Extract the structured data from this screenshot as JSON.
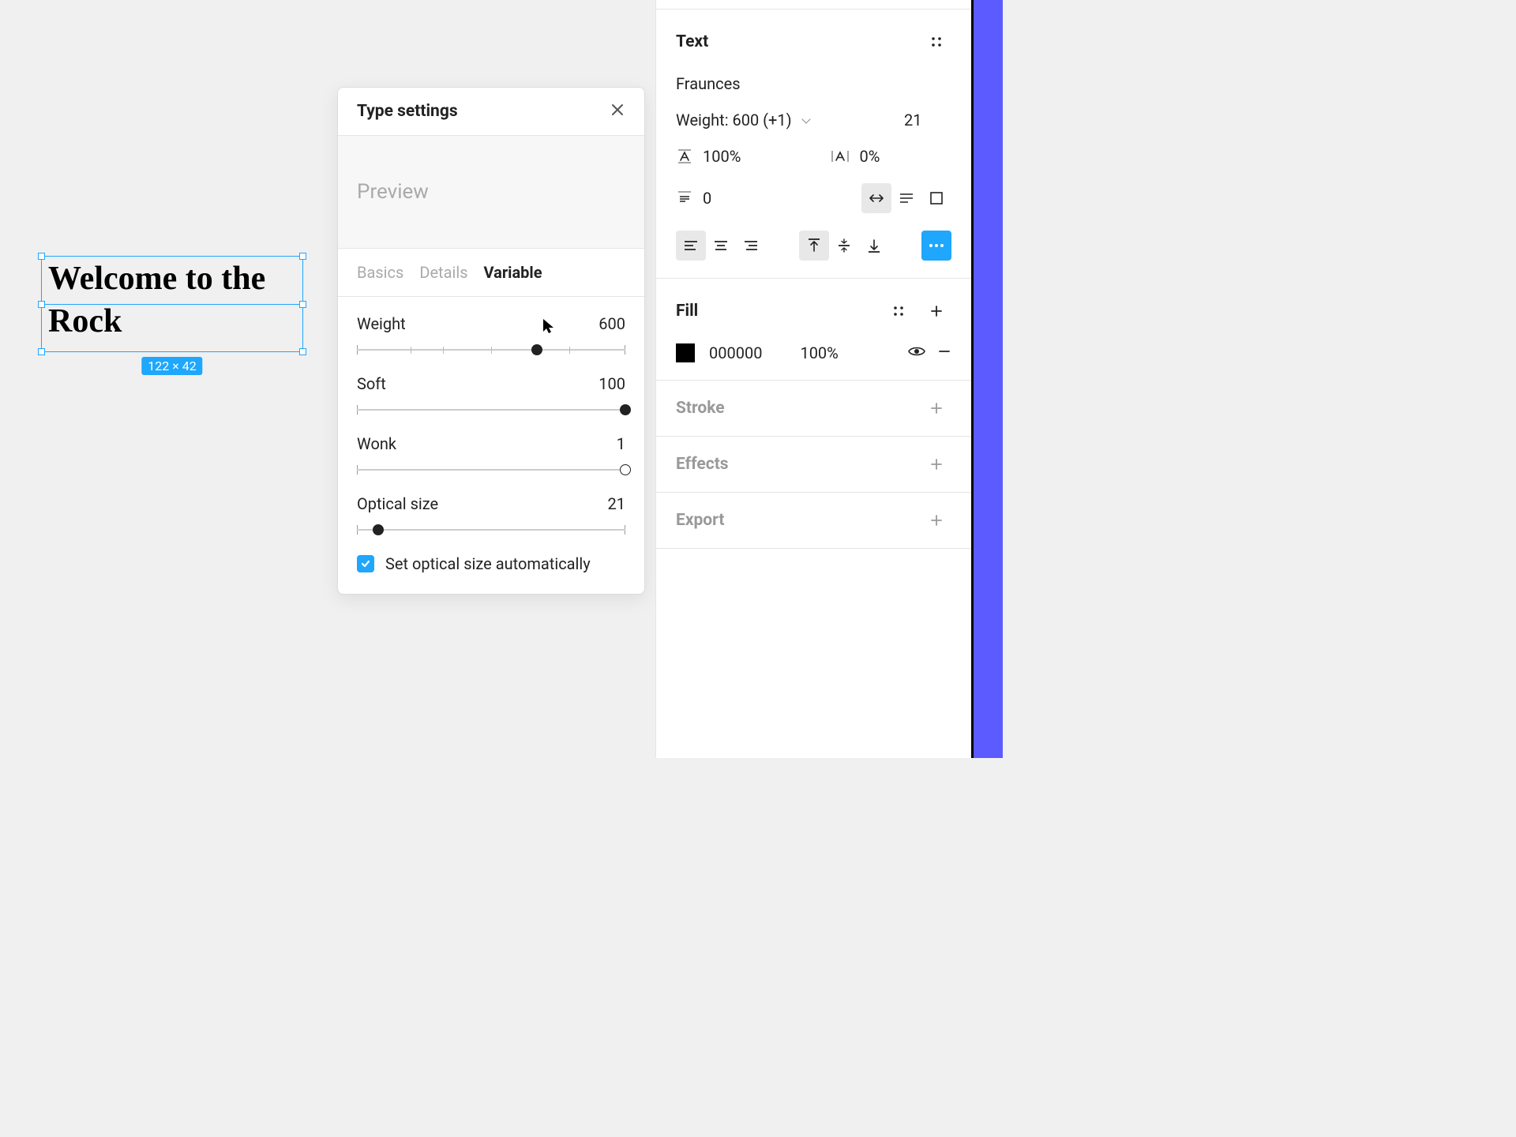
{
  "canvas": {
    "text": "Welcome to the Rock",
    "dimensions": "122 × 42"
  },
  "modal": {
    "title": "Type settings",
    "previewLabel": "Preview",
    "tabs": {
      "basics": "Basics",
      "details": "Details",
      "variable": "Variable"
    },
    "axes": {
      "weight": {
        "label": "Weight",
        "value": "600",
        "percent": 67
      },
      "soft": {
        "label": "Soft",
        "value": "100",
        "percent": 100
      },
      "wonk": {
        "label": "Wonk",
        "value": "1",
        "percent": 100
      },
      "optical": {
        "label": "Optical size",
        "value": "21",
        "percent": 8
      }
    },
    "checkboxLabel": "Set optical size automatically"
  },
  "inspector": {
    "text": {
      "title": "Text",
      "fontName": "Fraunces",
      "weight": "Weight: 600 (+1)",
      "size": "21",
      "lineHeight": "100%",
      "letterSpacing": "0%",
      "paragraphSpacing": "0"
    },
    "fill": {
      "title": "Fill",
      "hex": "000000",
      "opacity": "100%"
    },
    "stroke": {
      "title": "Stroke"
    },
    "effects": {
      "title": "Effects"
    },
    "export": {
      "title": "Export"
    }
  }
}
